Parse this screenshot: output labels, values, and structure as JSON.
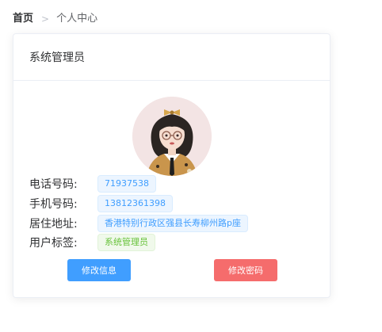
{
  "breadcrumb": {
    "home": "首页",
    "separator": ">",
    "current": "个人中心"
  },
  "card": {
    "title": "系统管理员",
    "avatar_icon": "user-avatar-illustration",
    "info": [
      {
        "label": "电话号码:",
        "value": "71937538"
      },
      {
        "label": "手机号码:",
        "value": "13812361398"
      },
      {
        "label": "居住地址:",
        "value": "香港特别行政区强县长寿柳州路p座"
      },
      {
        "label": "用户标签:",
        "value": "系统管理员"
      }
    ],
    "buttons": {
      "edit_info": "修改信息",
      "change_password": "修改密码"
    }
  },
  "colors": {
    "primary": "#409eff",
    "danger": "#f56c6c",
    "success": "#67c23a"
  }
}
